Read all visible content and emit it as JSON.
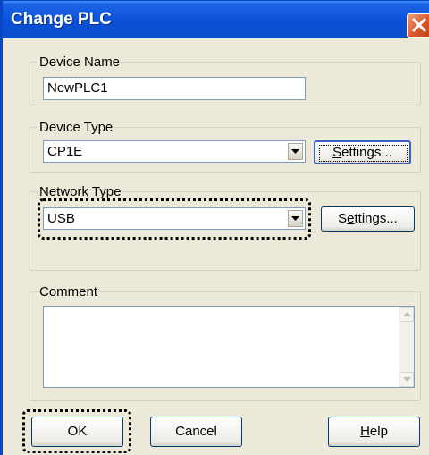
{
  "window": {
    "title": "Change PLC"
  },
  "device_name": {
    "label": "Device Name",
    "value": "NewPLC1"
  },
  "device_type": {
    "label": "Device Type",
    "selected": "CP1E",
    "settings_prefix": "",
    "settings_hotkey": "S",
    "settings_rest": "ettings..."
  },
  "network_type": {
    "label": "Network Type",
    "selected": "USB",
    "settings_prefix": "S",
    "settings_hotkey": "e",
    "settings_rest": "ttings..."
  },
  "comment": {
    "label": "Comment",
    "value": ""
  },
  "buttons": {
    "ok": "OK",
    "cancel": "Cancel",
    "help_hotkey": "H",
    "help_rest": "elp"
  },
  "icons": [
    "close-icon",
    "chevron-down-icon",
    "scroll-up-icon",
    "scroll-down-icon"
  ]
}
